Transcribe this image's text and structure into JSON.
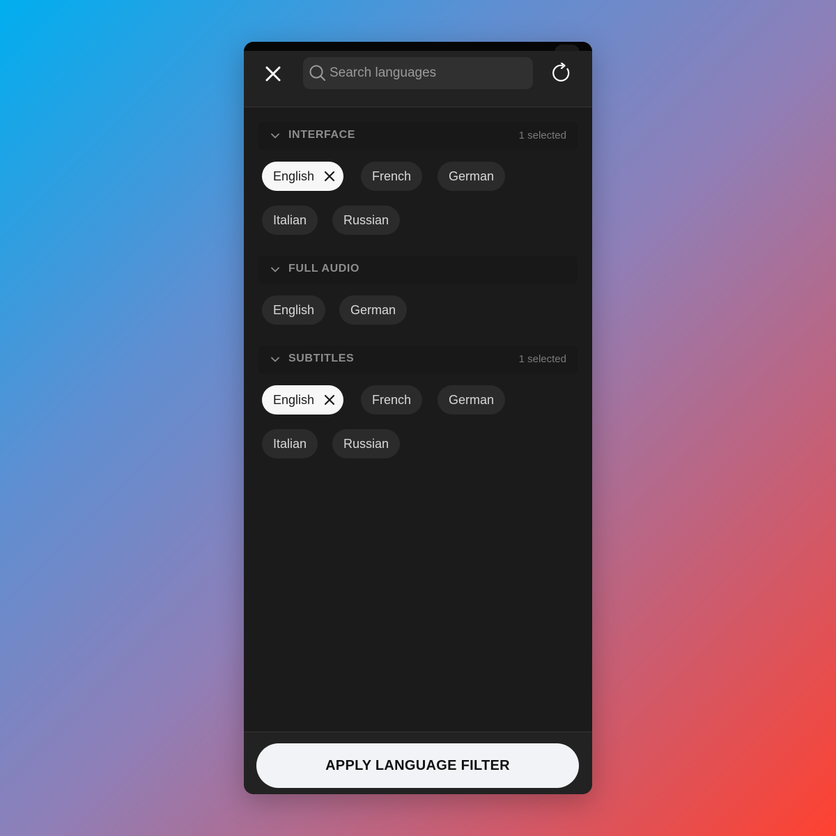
{
  "header": {
    "search_placeholder": "Search languages"
  },
  "sections": {
    "interface": {
      "title": "INTERFACE",
      "count": "1 selected",
      "chips": [
        {
          "label": "English",
          "selected": true
        },
        {
          "label": "French",
          "selected": false
        },
        {
          "label": "German",
          "selected": false
        },
        {
          "label": "Italian",
          "selected": false
        },
        {
          "label": "Russian",
          "selected": false
        }
      ]
    },
    "full_audio": {
      "title": "FULL AUDIO",
      "chips": [
        {
          "label": "English",
          "selected": false
        },
        {
          "label": "German",
          "selected": false
        }
      ]
    },
    "subtitles": {
      "title": "SUBTITLES",
      "count": "1 selected",
      "chips": [
        {
          "label": "English",
          "selected": true
        },
        {
          "label": "French",
          "selected": false
        },
        {
          "label": "German",
          "selected": false
        },
        {
          "label": "Italian",
          "selected": false
        },
        {
          "label": "Russian",
          "selected": false
        }
      ]
    }
  },
  "footer": {
    "apply_label": "APPLY LANGUAGE FILTER"
  },
  "icons": {
    "close": "close-icon",
    "search": "search-icon",
    "refresh": "refresh-icon",
    "chevron": "chevron-down-icon",
    "chip_remove": "remove-icon"
  },
  "colors": {
    "panel": "#1b1b1b",
    "header": "#222222",
    "chip": "#2b2b2b",
    "chip_selected": "#f7f7f7",
    "button": "#f2f3f6"
  }
}
